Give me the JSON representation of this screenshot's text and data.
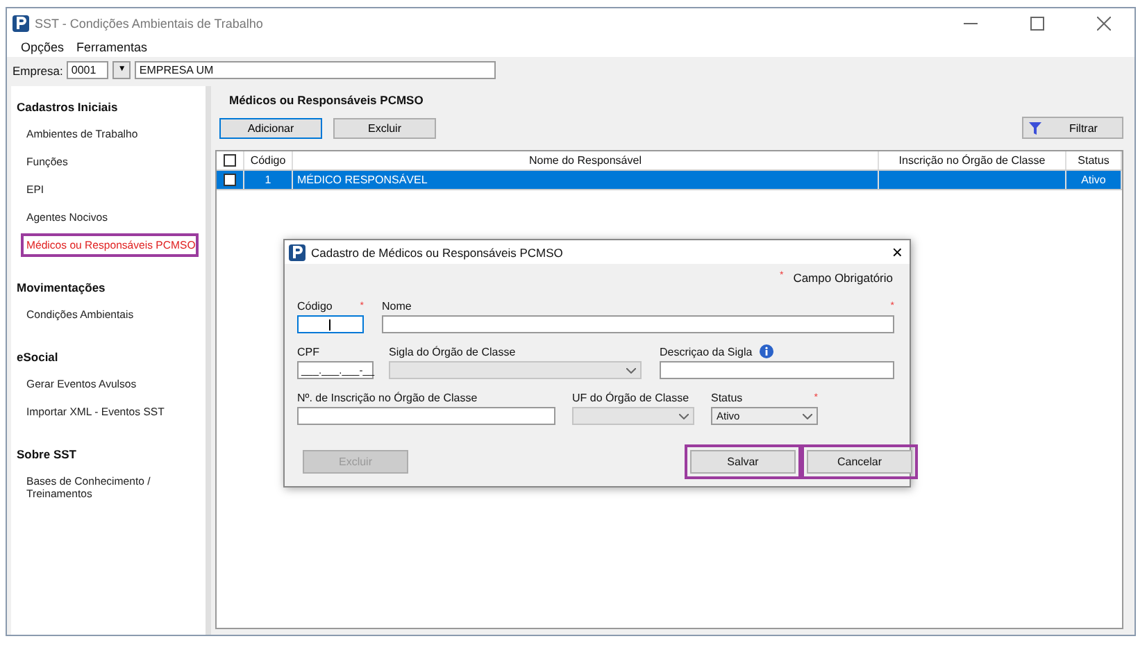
{
  "window": {
    "title": "SST - Condições Ambientais de Trabalho"
  },
  "menu": [
    "Opções",
    "Ferramentas"
  ],
  "company": {
    "label": "Empresa:",
    "code": "0001",
    "dropdown": "▼",
    "name": "EMPRESA UM"
  },
  "sidebar": [
    {
      "heading": "Cadastros Iniciais",
      "items": [
        {
          "label": "Ambientes de Trabalho",
          "selected": false
        },
        {
          "label": "Funções",
          "selected": false
        },
        {
          "label": "EPI",
          "selected": false
        },
        {
          "label": "Agentes Nocivos",
          "selected": false
        },
        {
          "label": "Médicos ou Responsáveis PCMSO",
          "selected": true
        }
      ]
    },
    {
      "heading": "Movimentações",
      "items": [
        {
          "label": "Condições Ambientais",
          "selected": false
        }
      ]
    },
    {
      "heading": "eSocial",
      "items": [
        {
          "label": "Gerar Eventos Avulsos",
          "selected": false
        },
        {
          "label": "Importar XML - Eventos SST",
          "selected": false
        }
      ]
    },
    {
      "heading": "Sobre SST",
      "items": [
        {
          "label": "Bases de Conhecimento / Treinamentos",
          "selected": false
        }
      ]
    }
  ],
  "main": {
    "title": "Médicos ou Responsáveis PCMSO",
    "buttons": [
      "Adicionar",
      "Excluir"
    ],
    "filter": "Filtrar"
  },
  "table": {
    "all_checked": false,
    "columns": [
      "Código",
      "Nome do Responsável",
      "Inscrição no Órgão de Classe",
      "Status"
    ],
    "rows": [
      {
        "checked": false,
        "selected": true,
        "cells": [
          "1",
          "MÉDICO RESPONSÁVEL",
          "",
          "Ativo"
        ]
      }
    ]
  },
  "dialog": {
    "title": "Cadastro de Médicos ou Responsáveis PCMSO",
    "close": "×",
    "legend": {
      "mark": "*",
      "text": "Campo Obrigatório"
    },
    "rows": [
      [
        {
          "kind": "text",
          "label": "Código",
          "required": true,
          "focused": true
        },
        {
          "kind": "text",
          "label": "Nome",
          "required": true,
          "focused": false
        }
      ],
      [
        {
          "kind": "text",
          "label": "CPF",
          "value": "___.___.___-__",
          "focused": false
        },
        {
          "kind": "select",
          "label": "Sigla do Órgão de Classe",
          "disabled": true
        },
        {
          "kind": "text",
          "label": "Descriçao da Sigla",
          "focused": false,
          "info": true
        }
      ],
      [
        {
          "kind": "text",
          "label": "Nº. de Inscrição no Órgão de Classe",
          "focused": false
        },
        {
          "kind": "select",
          "label": "UF do Órgão de Classe",
          "disabled": true
        },
        {
          "kind": "select",
          "label": "Status",
          "required": true,
          "value": "Ativo",
          "disabled": false
        }
      ]
    ],
    "buttons": [
      {
        "label": "Excluir",
        "disabled": true,
        "highlighted": false
      },
      {
        "label": "Salvar",
        "disabled": false,
        "highlighted": true
      },
      {
        "label": "Cancelar",
        "disabled": false,
        "highlighted": true
      }
    ]
  }
}
